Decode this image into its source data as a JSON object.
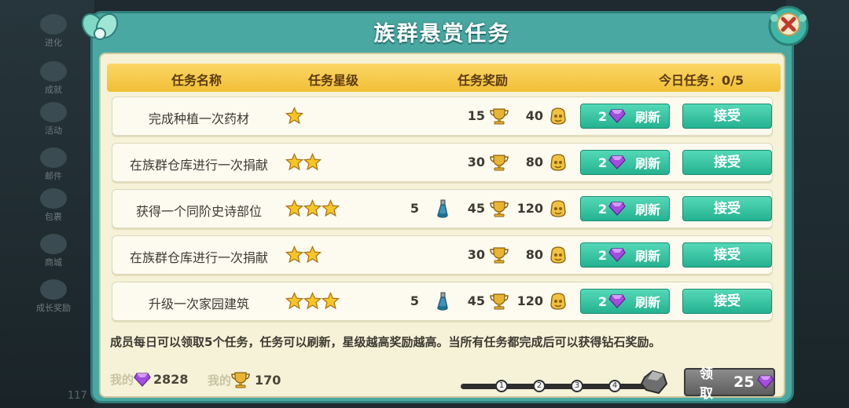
{
  "bg": {
    "side_items": [
      "进化",
      "成就",
      "活动",
      "邮件",
      "包裹",
      "商城",
      "成长奖励"
    ],
    "bottom_num": "117"
  },
  "dialog": {
    "title": "族群悬赏任务"
  },
  "header": {
    "col_name": "任务名称",
    "col_stars": "任务星级",
    "col_reward": "任务奖励",
    "today_label": "今日任务：0/5"
  },
  "tasks": [
    {
      "name": "完成种植一次药材",
      "stars": 1,
      "potion": "",
      "trophy": "15",
      "coin": "40",
      "refresh_cost": "2",
      "refresh_label": "刷新",
      "accept_label": "接受"
    },
    {
      "name": "在族群仓库进行一次捐献",
      "stars": 2,
      "potion": "",
      "trophy": "30",
      "coin": "80",
      "refresh_cost": "2",
      "refresh_label": "刷新",
      "accept_label": "接受"
    },
    {
      "name": "获得一个同阶史诗部位",
      "stars": 3,
      "potion": "5",
      "trophy": "45",
      "coin": "120",
      "refresh_cost": "2",
      "refresh_label": "刷新",
      "accept_label": "接受"
    },
    {
      "name": "在族群仓库进行一次捐献",
      "stars": 2,
      "potion": "",
      "trophy": "30",
      "coin": "80",
      "refresh_cost": "2",
      "refresh_label": "刷新",
      "accept_label": "接受"
    },
    {
      "name": "升级一次家园建筑",
      "stars": 3,
      "potion": "5",
      "trophy": "45",
      "coin": "120",
      "refresh_cost": "2",
      "refresh_label": "刷新",
      "accept_label": "接受"
    }
  ],
  "description": "成员每日可以领取5个任务，任务可以刷新，星级越高奖励越高。当所有任务都完成后可以获得钻石奖励。",
  "bottom": {
    "my_gems_label": "我的",
    "my_gems": "2828",
    "my_trophy_label": "我的",
    "my_trophy": "170",
    "progress_nodes": [
      "1",
      "2",
      "3",
      "4"
    ],
    "progress_completed": 0,
    "claim_label": "领取",
    "claim_count": "25"
  },
  "colors": {
    "dialog_teal": "#4aa8a2",
    "panel_cream": "#f6f2d8",
    "header_gold": "#f1bf36",
    "button_green": "#24b290",
    "claim_gray": "#5e5e5e",
    "gem_purple": "#9b3fd6"
  },
  "icons": {
    "star": "star-icon",
    "trophy": "trophy-icon",
    "coin": "coin-icon",
    "gem": "diamond-icon",
    "potion": "potion-icon",
    "close": "close-icon",
    "ore": "ore-icon"
  }
}
